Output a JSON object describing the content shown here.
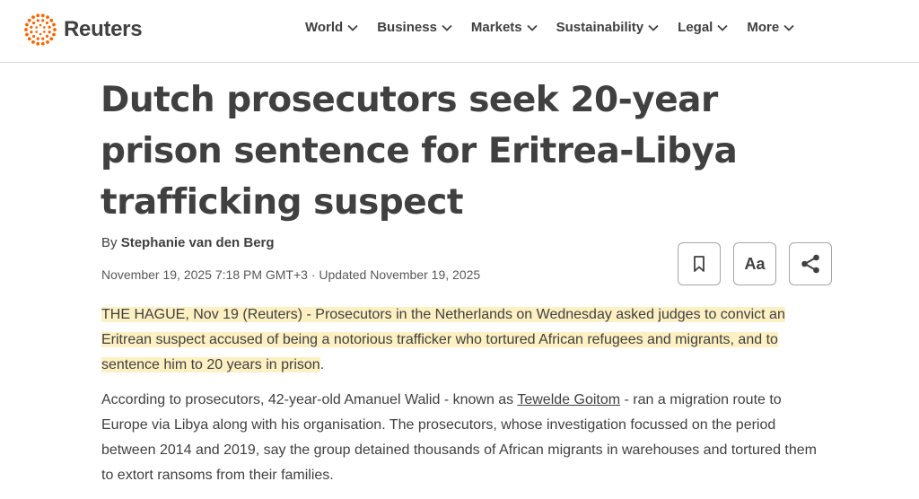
{
  "brand": {
    "name": "Reuters",
    "logo_icon": "reuters-dots-icon",
    "accent_color": "#fa6400"
  },
  "nav": {
    "items": [
      {
        "label": "World"
      },
      {
        "label": "Business"
      },
      {
        "label": "Markets"
      },
      {
        "label": "Sustainability"
      },
      {
        "label": "Legal"
      },
      {
        "label": "More"
      }
    ]
  },
  "article": {
    "headline": "Dutch prosecutors seek 20-year prison sentence for Eritrea-Libya trafficking suspect",
    "byline_prefix": "By",
    "author": "Stephanie van den Berg",
    "dateline": "November 19, 2025 7:18 PM GMT+3 · Updated November 19, 2025",
    "tools": {
      "bookmark_icon": "bookmark-icon",
      "text_size_label": "Aa",
      "share_icon": "share-icon"
    },
    "highlight_color": "#fdf0c2",
    "paragraphs": {
      "p1": {
        "highlighted": "THE HAGUE, Nov 19 (Reuters) - Prosecutors in the Netherlands on Wednesday asked judges to convict an Eritrean suspect accused of being a notorious trafficker who tortured African refugees and migrants, and to sentence him to 20 years in prison",
        "tail": "."
      },
      "p2": {
        "before": "According to prosecutors, 42-year-old Amanuel Walid - known as ",
        "link": "Tewelde Goitom",
        "after": " - ran a migration route to Europe via Libya along with his organisation. The prosecutors, whose investigation focussed on the period between 2014 and 2019, say the group detained thousands of African migrants in warehouses and tortured them to extort ransoms from their families."
      }
    }
  }
}
